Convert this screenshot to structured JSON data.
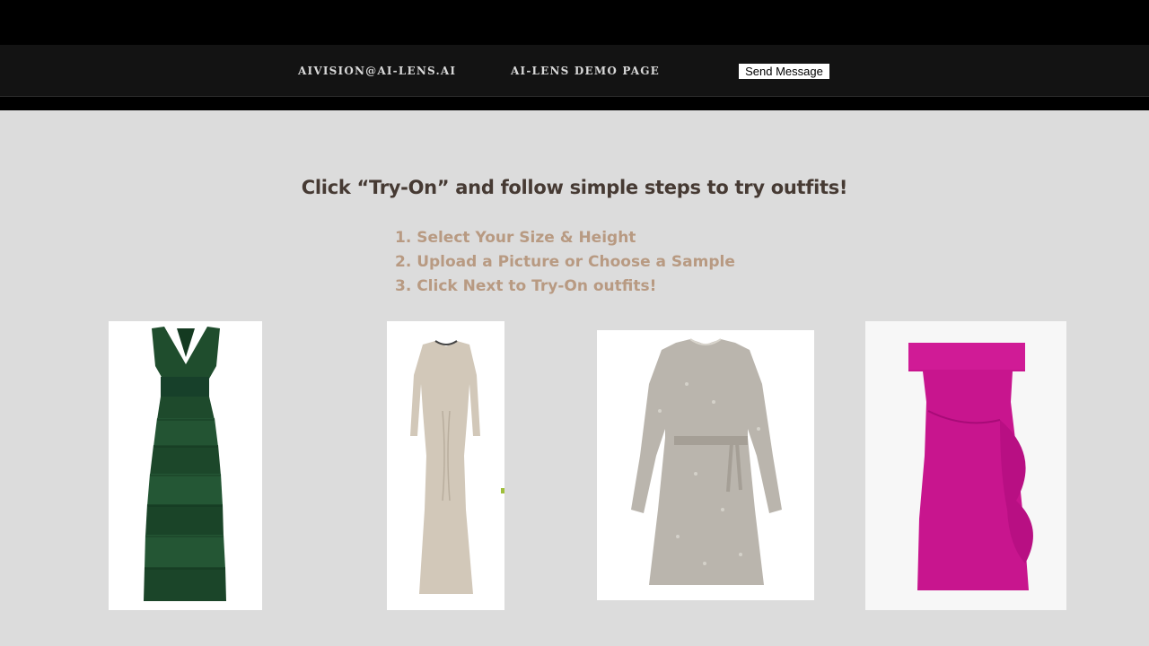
{
  "nav": {
    "email": "AIVISION@AI-LENS.AI",
    "demo": "AI-LENS DEMO PAGE",
    "send_button": "Send Message"
  },
  "main": {
    "headline": "Click “Try-On” and follow simple steps to try outfits!",
    "steps": [
      "1. Select Your Size & Height",
      "2. Upload a Picture or Choose a Sample",
      "3. Click Next to Try-On outfits!"
    ]
  },
  "products": [
    {
      "icon": "green-velvet-tiered-gown-image",
      "color": "#1e4a2c"
    },
    {
      "icon": "champagne-long-sleeve-gown-image",
      "color": "#d2c8b9"
    },
    {
      "icon": "silver-sequin-mini-dress-image",
      "color": "#b9b4ac"
    },
    {
      "icon": "magenta-off-shoulder-dress-image",
      "color": "#c8158e"
    }
  ]
}
